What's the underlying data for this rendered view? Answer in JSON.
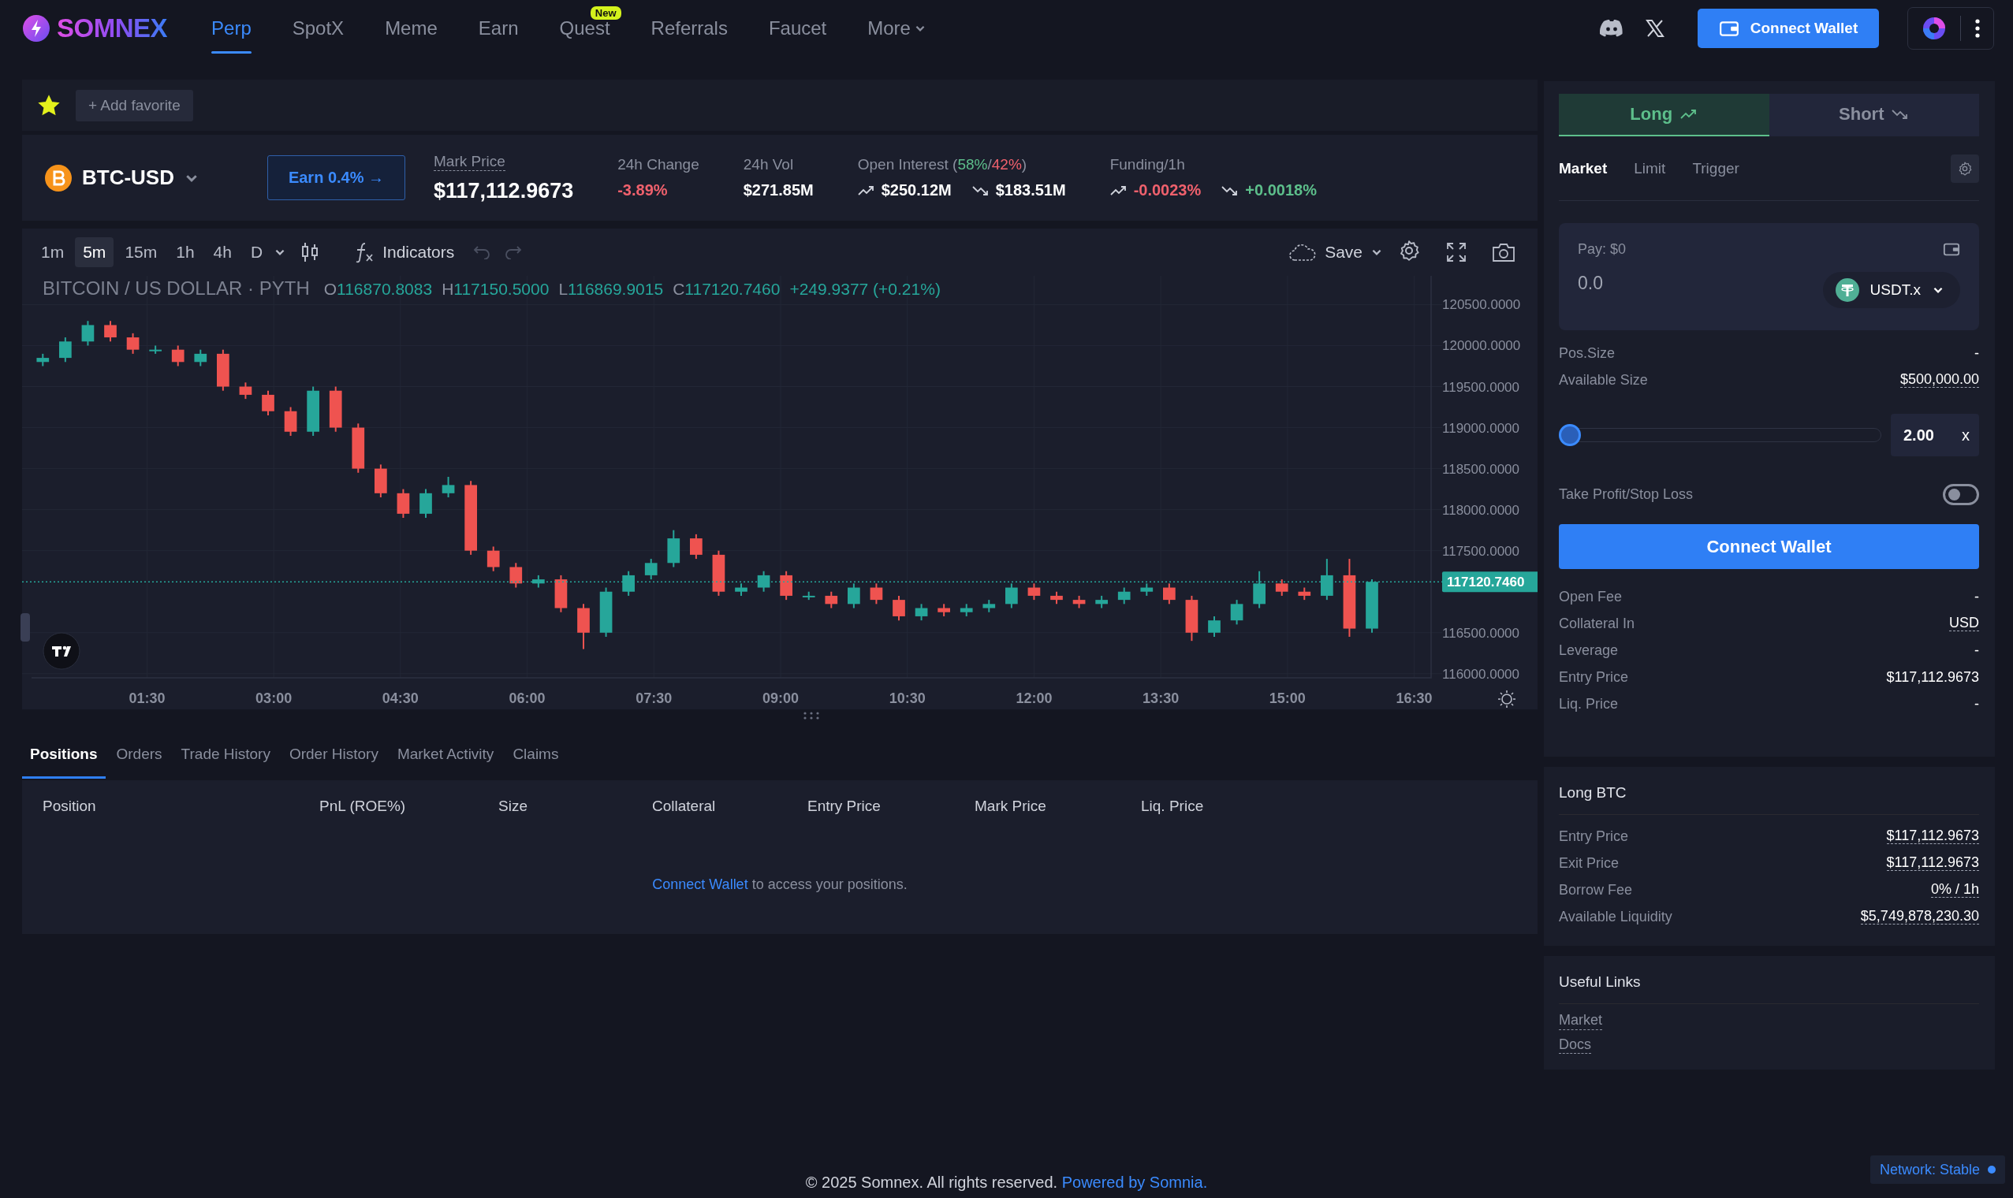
{
  "brand": {
    "name": "SOMNEX"
  },
  "nav": {
    "items": [
      {
        "label": "Perp",
        "selected": true,
        "kind": "link"
      },
      {
        "label": "SpotX",
        "selected": false,
        "kind": "link"
      },
      {
        "label": "Meme",
        "selected": false,
        "kind": "link"
      },
      {
        "label": "Earn",
        "selected": false,
        "kind": "link"
      },
      {
        "label": "Quest",
        "selected": false,
        "kind": "link",
        "badge": "New"
      },
      {
        "label": "Referrals",
        "selected": false,
        "kind": "link"
      },
      {
        "label": "Faucet",
        "selected": false,
        "kind": "link"
      },
      {
        "label": "More",
        "selected": false,
        "kind": "dropdown"
      }
    ],
    "connect_button": "Connect Wallet"
  },
  "favorites": {
    "starred": true,
    "add_label": "+ Add favorite"
  },
  "market": {
    "pair": "BTC-USD",
    "earn_button": "Earn 0.4% →",
    "stats": [
      {
        "kind": "mark",
        "label_parts": [
          {
            "text": "Mark Price",
            "color": "#8a8f9e"
          }
        ],
        "values": [
          {
            "text": "$117,112.9673",
            "color": "#ffffff",
            "kind": "plain"
          }
        ]
      },
      {
        "kind": "plain",
        "label_parts": [
          {
            "text": "24h Change",
            "color": "#8a8f9e"
          }
        ],
        "values": [
          {
            "text": "-3.89%",
            "color": "#f0616d",
            "kind": "plain"
          }
        ]
      },
      {
        "kind": "plain",
        "label_parts": [
          {
            "text": "24h Vol",
            "color": "#8a8f9e"
          }
        ],
        "values": [
          {
            "text": "$271.85M",
            "color": "#ffffff",
            "kind": "plain"
          }
        ]
      },
      {
        "kind": "plain",
        "label_parts": [
          {
            "text": "Open Interest (",
            "color": "#8a8f9e"
          },
          {
            "text": "58%",
            "color": "#5dbf8b"
          },
          {
            "text": "/",
            "color": "#8a8f9e"
          },
          {
            "text": "42%",
            "color": "#f0616d"
          },
          {
            "text": ")",
            "color": "#8a8f9e"
          }
        ],
        "values": [
          {
            "text": "$250.12M",
            "color": "#ffffff",
            "kind": "trend-up"
          },
          {
            "text": "$183.51M",
            "color": "#ffffff",
            "kind": "trend-down"
          }
        ]
      },
      {
        "kind": "plain",
        "label_parts": [
          {
            "text": "Funding/1h",
            "color": "#8a8f9e"
          }
        ],
        "values": [
          {
            "text": "-0.0023%",
            "color": "#f0616d",
            "kind": "trend-up"
          },
          {
            "text": "+0.0018%",
            "color": "#5dbf8b",
            "kind": "trend-down"
          }
        ]
      }
    ]
  },
  "chart": {
    "intervals": [
      {
        "label": "1m",
        "selected": false
      },
      {
        "label": "5m",
        "selected": true
      },
      {
        "label": "15m",
        "selected": false
      },
      {
        "label": "1h",
        "selected": false
      },
      {
        "label": "4h",
        "selected": false
      },
      {
        "label": "D",
        "selected": false
      }
    ],
    "indicators_label": "Indicators",
    "save_label": "Save",
    "legend": {
      "title": "BITCOIN / US DOLLAR · PYTH",
      "ohlc": [
        {
          "key": "O",
          "value": "116870.8083"
        },
        {
          "key": "H",
          "value": "117150.5000"
        },
        {
          "key": "L",
          "value": "116869.9015"
        },
        {
          "key": "C",
          "value": "117120.7460"
        }
      ],
      "change": "+249.9377 (+0.21%)"
    },
    "chart_data": {
      "type": "candlestick",
      "grid": true,
      "x": [
        16,
        32,
        48,
        64,
        80,
        96,
        112,
        128,
        144,
        160,
        176,
        192,
        208,
        224,
        240,
        256,
        272,
        288,
        304,
        320,
        336,
        352,
        368,
        384,
        400,
        416,
        432,
        448,
        464,
        480,
        496,
        512,
        528,
        544,
        560,
        576,
        592,
        608,
        624,
        640,
        656,
        672,
        688,
        704,
        720,
        736,
        752,
        768,
        784,
        800,
        816,
        832,
        848,
        864,
        880,
        896,
        912,
        928,
        944,
        960
      ],
      "ohlc": [
        [
          119800,
          119900,
          119750,
          119850
        ],
        [
          119850,
          120100,
          119800,
          120050
        ],
        [
          120050,
          120300,
          120000,
          120250
        ],
        [
          120250,
          120300,
          120050,
          120100
        ],
        [
          120100,
          120150,
          119900,
          119950
        ],
        [
          119950,
          120000,
          119900,
          119950
        ],
        [
          119950,
          120000,
          119750,
          119800
        ],
        [
          119800,
          119950,
          119750,
          119900
        ],
        [
          119900,
          119950,
          119450,
          119500
        ],
        [
          119500,
          119550,
          119350,
          119400
        ],
        [
          119400,
          119450,
          119150,
          119200
        ],
        [
          119200,
          119250,
          118900,
          118950
        ],
        [
          118950,
          119500,
          118900,
          119450
        ],
        [
          119450,
          119500,
          118950,
          119000
        ],
        [
          119000,
          119050,
          118450,
          118500
        ],
        [
          118500,
          118550,
          118150,
          118200
        ],
        [
          118200,
          118250,
          117900,
          117950
        ],
        [
          117950,
          118250,
          117900,
          118200
        ],
        [
          118200,
          118400,
          118150,
          118300
        ],
        [
          118300,
          118350,
          117450,
          117500
        ],
        [
          117500,
          117550,
          117250,
          117300
        ],
        [
          117300,
          117350,
          117050,
          117100
        ],
        [
          117100,
          117200,
          117050,
          117150
        ],
        [
          117150,
          117200,
          116750,
          116800
        ],
        [
          116800,
          116850,
          116300,
          116500
        ],
        [
          116500,
          117050,
          116450,
          117000
        ],
        [
          117000,
          117250,
          116950,
          117200
        ],
        [
          117200,
          117400,
          117150,
          117350
        ],
        [
          117350,
          117750,
          117300,
          117650
        ],
        [
          117650,
          117700,
          117400,
          117450
        ],
        [
          117450,
          117500,
          116950,
          117000
        ],
        [
          117000,
          117100,
          116950,
          117050
        ],
        [
          117050,
          117250,
          117000,
          117200
        ],
        [
          117200,
          117250,
          116900,
          116950
        ],
        [
          116950,
          117000,
          116900,
          116950
        ],
        [
          116950,
          117000,
          116800,
          116850
        ],
        [
          116850,
          117100,
          116800,
          117050
        ],
        [
          117050,
          117100,
          116850,
          116900
        ],
        [
          116900,
          116950,
          116650,
          116700
        ],
        [
          116700,
          116850,
          116650,
          116800
        ],
        [
          116800,
          116850,
          116700,
          116750
        ],
        [
          116750,
          116850,
          116700,
          116800
        ],
        [
          116800,
          116900,
          116750,
          116850
        ],
        [
          116850,
          117100,
          116800,
          117050
        ],
        [
          117050,
          117100,
          116900,
          116950
        ],
        [
          116950,
          117000,
          116850,
          116900
        ],
        [
          116900,
          116950,
          116800,
          116850
        ],
        [
          116850,
          116950,
          116800,
          116900
        ],
        [
          116900,
          117050,
          116850,
          117000
        ],
        [
          117000,
          117100,
          116950,
          117050
        ],
        [
          117050,
          117100,
          116850,
          116900
        ],
        [
          116900,
          116950,
          116400,
          116500
        ],
        [
          116500,
          116700,
          116450,
          116650
        ],
        [
          116650,
          116900,
          116600,
          116850
        ],
        [
          116850,
          117250,
          116800,
          117100
        ],
        [
          117100,
          117150,
          116950,
          117000
        ],
        [
          117000,
          117050,
          116900,
          116950
        ],
        [
          116950,
          117400,
          116900,
          117200
        ],
        [
          117200,
          117400,
          116450,
          116550
        ],
        [
          116550,
          117150,
          116500,
          117120
        ]
      ],
      "xlim": [
        8,
        1002
      ],
      "ylim": [
        115950,
        120850
      ],
      "xticks": [
        {
          "value": 90,
          "label": "01:30"
        },
        {
          "value": 180,
          "label": "03:00"
        },
        {
          "value": 270,
          "label": "04:30"
        },
        {
          "value": 360,
          "label": "06:00"
        },
        {
          "value": 450,
          "label": "07:30"
        },
        {
          "value": 540,
          "label": "09:00"
        },
        {
          "value": 630,
          "label": "10:30"
        },
        {
          "value": 720,
          "label": "12:00"
        },
        {
          "value": 810,
          "label": "13:30"
        },
        {
          "value": 900,
          "label": "15:00"
        },
        {
          "value": 990,
          "label": "16:30"
        }
      ],
      "yticks": [
        {
          "value": 120500,
          "label": "120500.0000"
        },
        {
          "value": 120000,
          "label": "120000.0000"
        },
        {
          "value": 119500,
          "label": "119500.0000"
        },
        {
          "value": 119000,
          "label": "119000.0000"
        },
        {
          "value": 118500,
          "label": "118500.0000"
        },
        {
          "value": 118000,
          "label": "118000.0000"
        },
        {
          "value": 117500,
          "label": "117500.0000"
        },
        {
          "value": 116500,
          "label": "116500.0000"
        },
        {
          "value": 116000,
          "label": "116000.0000"
        }
      ],
      "ref_lines": [
        {
          "axis": "y",
          "value": 117120.746,
          "label": "117120.7460",
          "color": "#26a69a"
        }
      ]
    }
  },
  "positions": {
    "tabs": [
      {
        "label": "Positions",
        "selected": true
      },
      {
        "label": "Orders",
        "selected": false
      },
      {
        "label": "Trade History",
        "selected": false
      },
      {
        "label": "Order History",
        "selected": false
      },
      {
        "label": "Market Activity",
        "selected": false
      },
      {
        "label": "Claims",
        "selected": false
      }
    ],
    "columns": [
      "Position",
      "PnL (ROE%)",
      "Size",
      "Collateral",
      "Entry Price",
      "Mark Price",
      "Liq. Price"
    ],
    "empty": {
      "link": "Connect Wallet",
      "text": " to access your positions."
    }
  },
  "trade": {
    "sides": [
      {
        "label": "Long",
        "selected": true,
        "kind": "long"
      },
      {
        "label": "Short",
        "selected": false,
        "kind": "short"
      }
    ],
    "order_types": [
      {
        "label": "Market",
        "selected": true
      },
      {
        "label": "Limit",
        "selected": false
      },
      {
        "label": "Trigger",
        "selected": false
      }
    ],
    "pay": {
      "label": "Pay: $0",
      "placeholder": "0.0",
      "token": "USDT.x"
    },
    "size_rows": [
      {
        "label": "Pos.Size",
        "value": "-",
        "dashed": false
      },
      {
        "label": "Available Size",
        "value": "$500,000.00",
        "dashed": true
      }
    ],
    "leverage": {
      "level": 0,
      "value": "2.00",
      "unit": "x"
    },
    "tp_sl": {
      "label": "Take Profit/Stop Loss",
      "on": false
    },
    "button": "Connect Wallet",
    "rows": [
      {
        "label": "Open Fee",
        "value": "-",
        "dashed": false
      },
      {
        "label": "Collateral In",
        "value": "USD",
        "dashed": true
      },
      {
        "label": "Leverage",
        "value": "-",
        "dashed": false
      },
      {
        "label": "Entry Price",
        "value": "$117,112.9673",
        "dashed": false
      },
      {
        "label": "Liq. Price",
        "value": "-",
        "dashed": false
      }
    ]
  },
  "summary": {
    "title": "Long BTC",
    "rows": [
      {
        "label": "Entry Price",
        "value": "$117,112.9673",
        "dashed": true
      },
      {
        "label": "Exit Price",
        "value": "$117,112.9673",
        "dashed": true
      },
      {
        "label": "Borrow Fee",
        "value": "0% / 1h",
        "dashed": true
      },
      {
        "label": "Available Liquidity",
        "value": "$5,749,878,230.30",
        "dashed": true
      }
    ]
  },
  "useful_links": {
    "title": "Useful Links",
    "links": [
      "Market",
      "Docs"
    ]
  },
  "footer": {
    "text": "© 2025 Somnex. All rights reserved. ",
    "link": "Powered by Somnia."
  },
  "network": {
    "label": "Network: Stable"
  }
}
